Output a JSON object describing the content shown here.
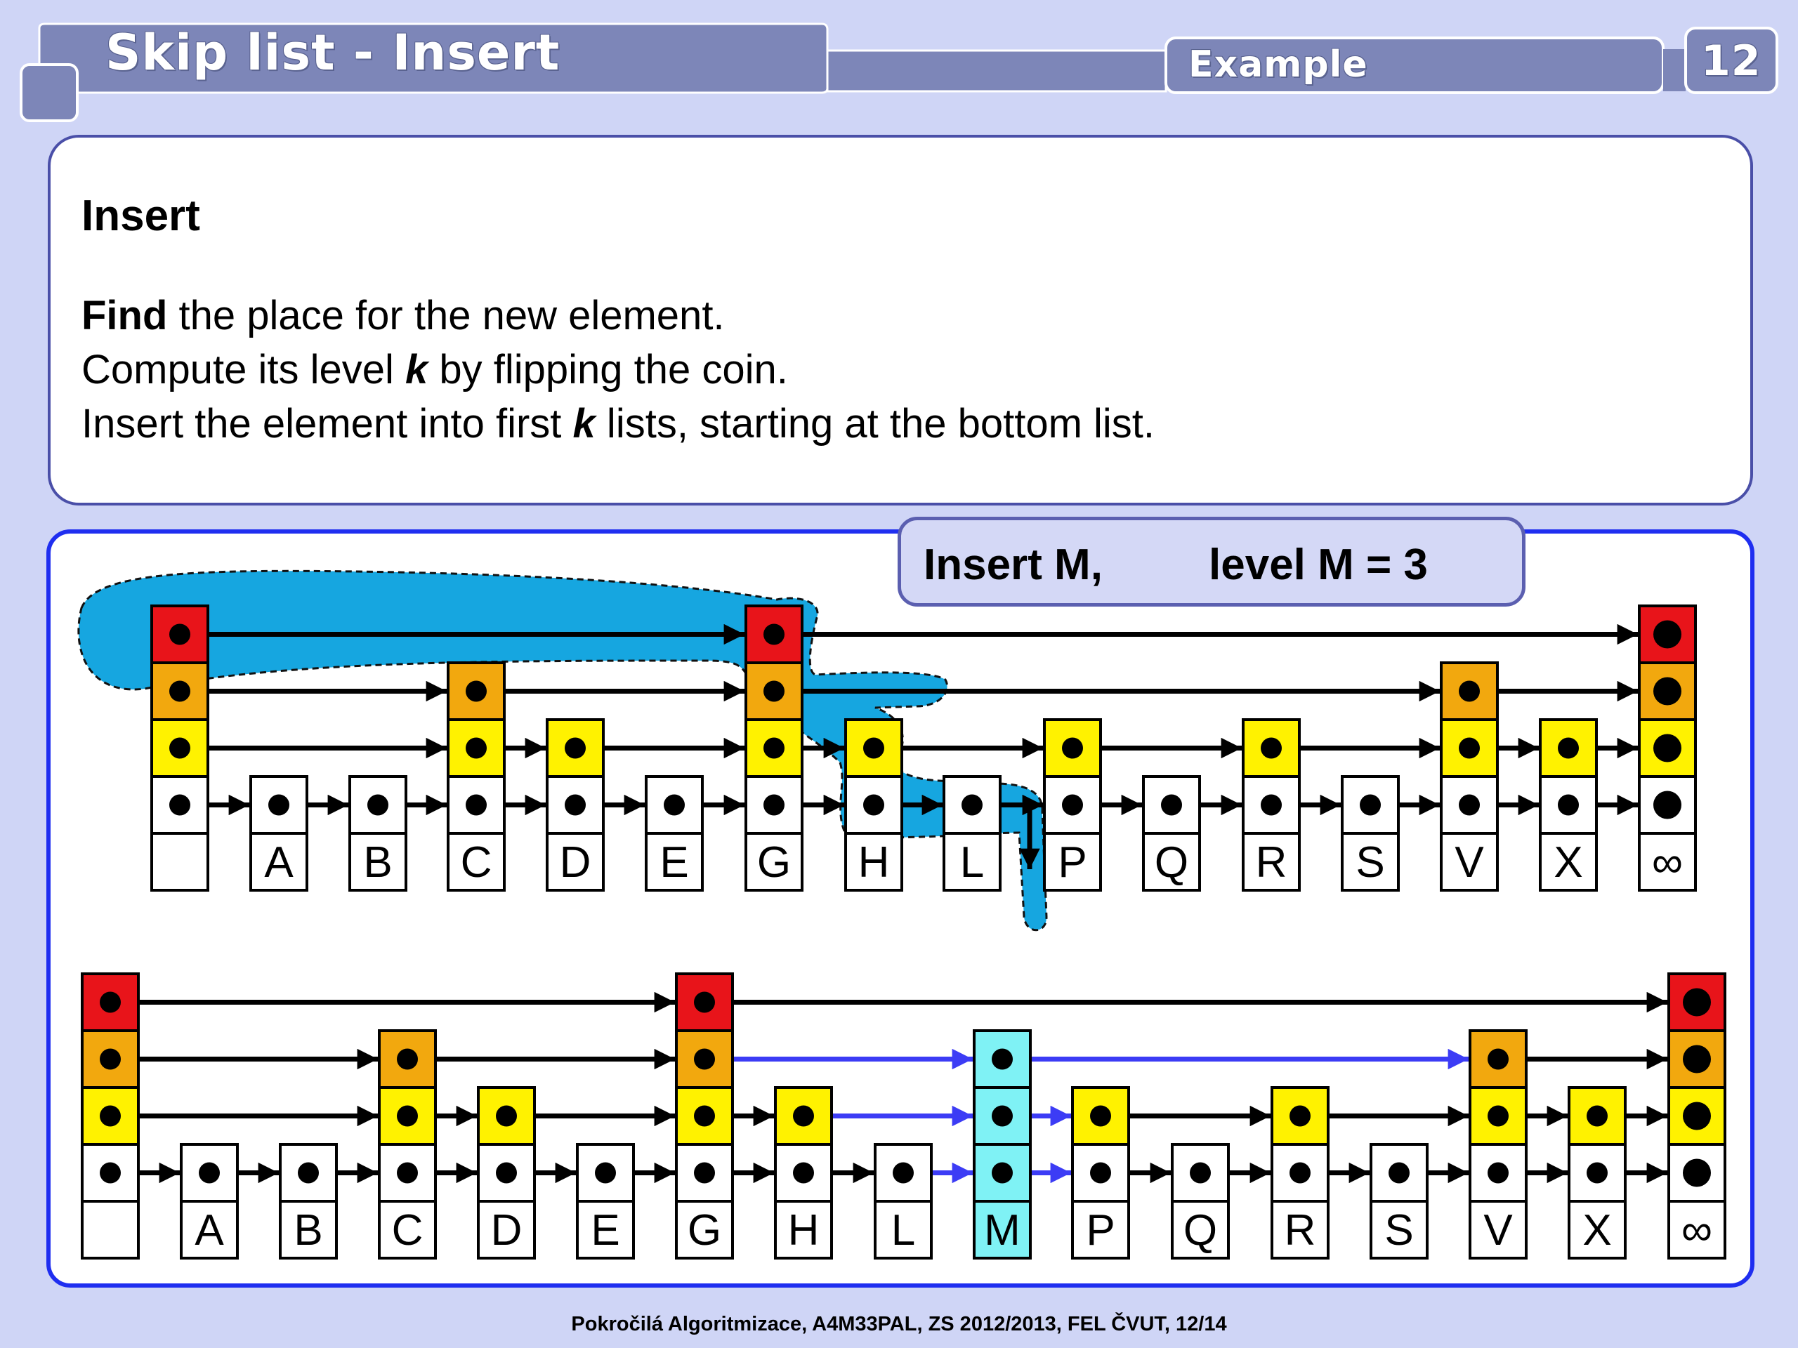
{
  "header": {
    "title": "Skip list - Insert",
    "tag": "Example",
    "page_number": "12"
  },
  "content": {
    "heading": "Insert",
    "line1": {
      "bold": "Find",
      "rest": " the place for the new element."
    },
    "line2": {
      "pre": "Compute its level ",
      "var": "k",
      "post": " by flipping the coin."
    },
    "line3": {
      "pre": "Insert the element into first ",
      "var": "k",
      "post": " lists, starting at the bottom list."
    }
  },
  "callout": {
    "label": "Insert M,",
    "level": "level M = 3"
  },
  "colors": {
    "level4": "#e8141a",
    "level3": "#f2a80e",
    "level2": "#fff200",
    "level1": "#ffffff",
    "new_element": "#7ff2f5",
    "search_path": "#16a6e0",
    "new_links": "#3c3cf5"
  },
  "diagrams": {
    "before": {
      "nodes": [
        {
          "key": "",
          "height": 4
        },
        {
          "key": "A",
          "height": 1
        },
        {
          "key": "B",
          "height": 1
        },
        {
          "key": "C",
          "height": 3
        },
        {
          "key": "D",
          "height": 2
        },
        {
          "key": "E",
          "height": 1
        },
        {
          "key": "G",
          "height": 4
        },
        {
          "key": "H",
          "height": 2
        },
        {
          "key": "L",
          "height": 1
        },
        {
          "key": "P",
          "height": 2
        },
        {
          "key": "Q",
          "height": 1
        },
        {
          "key": "R",
          "height": 2
        },
        {
          "key": "S",
          "height": 1
        },
        {
          "key": "V",
          "height": 3
        },
        {
          "key": "X",
          "height": 2
        },
        {
          "key": "∞",
          "height": 4
        }
      ]
    },
    "after": {
      "inserted": "M",
      "nodes": [
        {
          "key": "",
          "height": 4
        },
        {
          "key": "A",
          "height": 1
        },
        {
          "key": "B",
          "height": 1
        },
        {
          "key": "C",
          "height": 3
        },
        {
          "key": "D",
          "height": 2
        },
        {
          "key": "E",
          "height": 1
        },
        {
          "key": "G",
          "height": 4
        },
        {
          "key": "H",
          "height": 2
        },
        {
          "key": "L",
          "height": 1
        },
        {
          "key": "M",
          "height": 3
        },
        {
          "key": "P",
          "height": 2
        },
        {
          "key": "Q",
          "height": 1
        },
        {
          "key": "R",
          "height": 2
        },
        {
          "key": "S",
          "height": 1
        },
        {
          "key": "V",
          "height": 3
        },
        {
          "key": "X",
          "height": 2
        },
        {
          "key": "∞",
          "height": 4
        }
      ]
    }
  },
  "footer": "Pokročilá Algoritmizace, A4M33PAL, ZS 2012/2013, FEL ČVUT,  12/14"
}
